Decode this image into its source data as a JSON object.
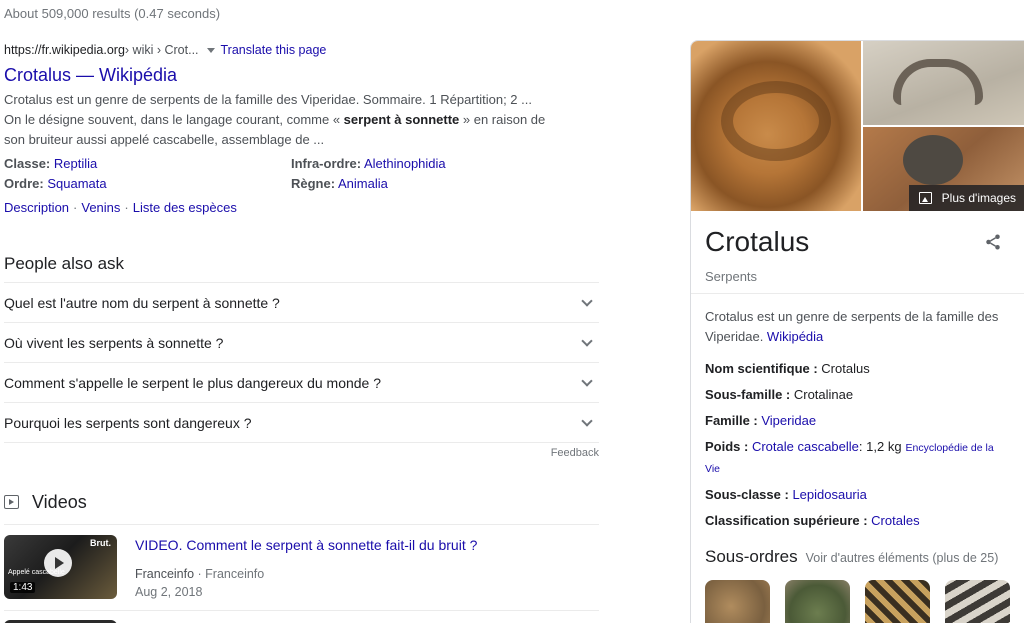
{
  "stats": "About 509,000 results (0.47 seconds)",
  "result": {
    "url": "https://fr.wikipedia.org",
    "crumbs": " › wiki › Crot...",
    "translate": "Translate this page",
    "title": "Crotalus — Wikipédia",
    "snippet_1": "Crotalus est un genre de serpents de la famille des Viperidae. Sommaire. 1 Répartition; 2 ... On le désigne souvent, dans le langage courant, comme « ",
    "snippet_bold": "serpent à sonnette",
    "snippet_2": " » en raison de son bruiteur aussi appelé cascabelle, assemblage de ...",
    "facts": [
      {
        "key": "Classe:",
        "value": "Reptilia"
      },
      {
        "key": "Infra-ordre:",
        "value": "Alethinophidia"
      },
      {
        "key": "Ordre:",
        "value": "Squamata"
      },
      {
        "key": "Règne:",
        "value": "Animalia"
      }
    ],
    "sitelinks": [
      "Description",
      "Venins",
      "Liste des espèces"
    ]
  },
  "paa": {
    "heading": "People also ask",
    "questions": [
      "Quel est l'autre nom du serpent à sonnette ?",
      "Où vivent les serpents à sonnette ?",
      "Comment s'appelle le serpent le plus dangereux du monde ?",
      "Pourquoi les serpents sont dangereux ?"
    ],
    "feedback": "Feedback"
  },
  "videos": {
    "heading": "Videos",
    "items": [
      {
        "title": "VIDEO. Comment le serpent à sonnette fait-il du bruit ?",
        "source": "Franceinfo",
        "channel": "Franceinfo",
        "date": "Aug 2, 2018",
        "duration": "1:43",
        "badge": "Brut.",
        "caption": "Appelé cascabelle"
      }
    ]
  },
  "knowledge_panel": {
    "more_images": "Plus d'images",
    "title": "Crotalus",
    "subtitle": "Serpents",
    "description": "Crotalus est un genre de serpents de la famille des Viperidae. ",
    "description_link": "Wikipédia",
    "attributes": [
      {
        "key": "Nom scientifique : ",
        "value": "Crotalus",
        "link": false
      },
      {
        "key": "Sous-famille : ",
        "value": "Crotalinae",
        "link": false
      },
      {
        "key": "Famille : ",
        "value": "Viperidae",
        "link": true
      },
      {
        "key": "Poids : ",
        "value": "Crotale cascabelle",
        "link": true,
        "extra": ": 1,2 kg",
        "source": "Encyclopédie de la Vie"
      },
      {
        "key": "Sous-classe : ",
        "value": "Lepidosauria",
        "link": true
      },
      {
        "key": "Classification supérieure : ",
        "value": "Crotales",
        "link": true
      }
    ],
    "sous_ordres": "Sous-ordres",
    "sous_ordres_more": "Voir d'autres éléments (plus de 25)"
  }
}
